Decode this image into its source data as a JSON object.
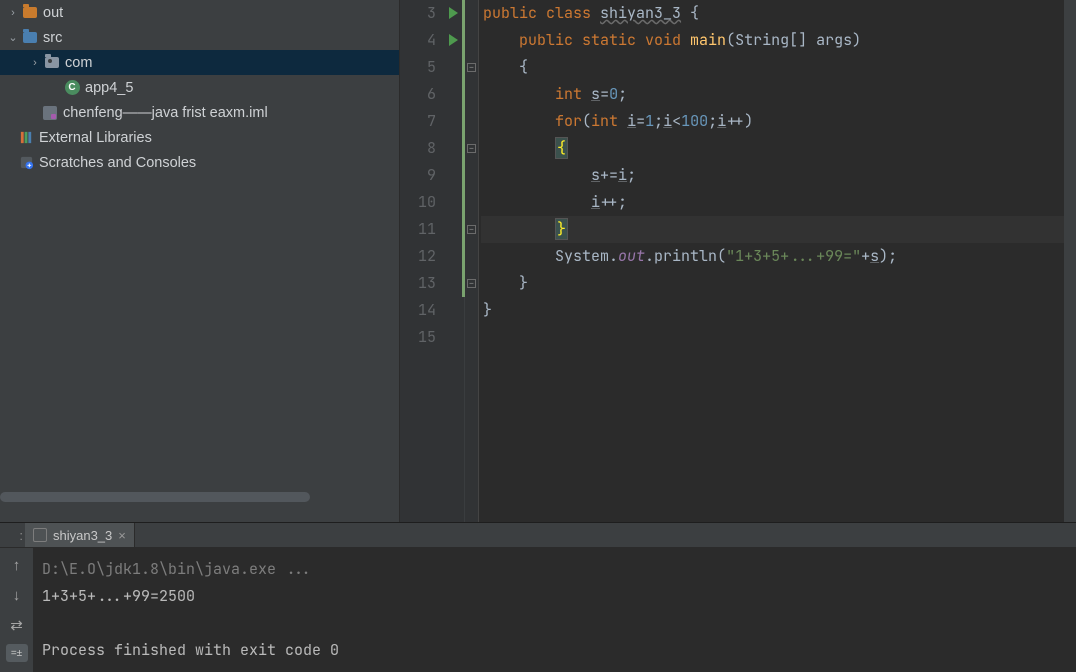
{
  "tree": {
    "out": "out",
    "src": "src",
    "com": "com",
    "app": "app4_5",
    "iml": "chenfeng——java frist eaxm.iml",
    "ext": "External Libraries",
    "scratch": "Scratches and Consoles"
  },
  "gutter_run_lines": [
    3,
    4
  ],
  "code": {
    "lines": [
      3,
      4,
      5,
      6,
      7,
      8,
      9,
      10,
      11,
      12,
      13,
      14,
      15
    ],
    "class_kw": "public class",
    "class_name": "shiyan3_3",
    "open_brace": " {",
    "method_sig_pre": "public static void",
    "method_name": "main",
    "method_args": "(String[] args)",
    "lbrace": "{",
    "rbrace": "}",
    "int_decl_kw": "int",
    "s_var": "s",
    "eq0": "=",
    "zero": "0",
    "semi": ";",
    "for_kw": "for",
    "for_open": "(",
    "int_kw": "int",
    "i_var": "i",
    "eq": "=",
    "one": "1",
    "lt": "<",
    "hundred": "100",
    "ipp": "++",
    "for_close": ")",
    "s_pluseq": "+=",
    "sysout_pre": "System.",
    "sysout_out": "out",
    "sysout_call": ".println(",
    "sysout_str": "\"1+3+5+...+99=\"",
    "sysout_plus": "+",
    "sysout_end": ");"
  },
  "run": {
    "tab_label": "shiyan3_3",
    "panel_marker": ":",
    "path": "D:\\E.O\\jdk1.8\\bin\\java.exe ...",
    "output": "1+3+5+...+99=2500",
    "exit": "Process finished with exit code 0",
    "badge": "=±"
  }
}
